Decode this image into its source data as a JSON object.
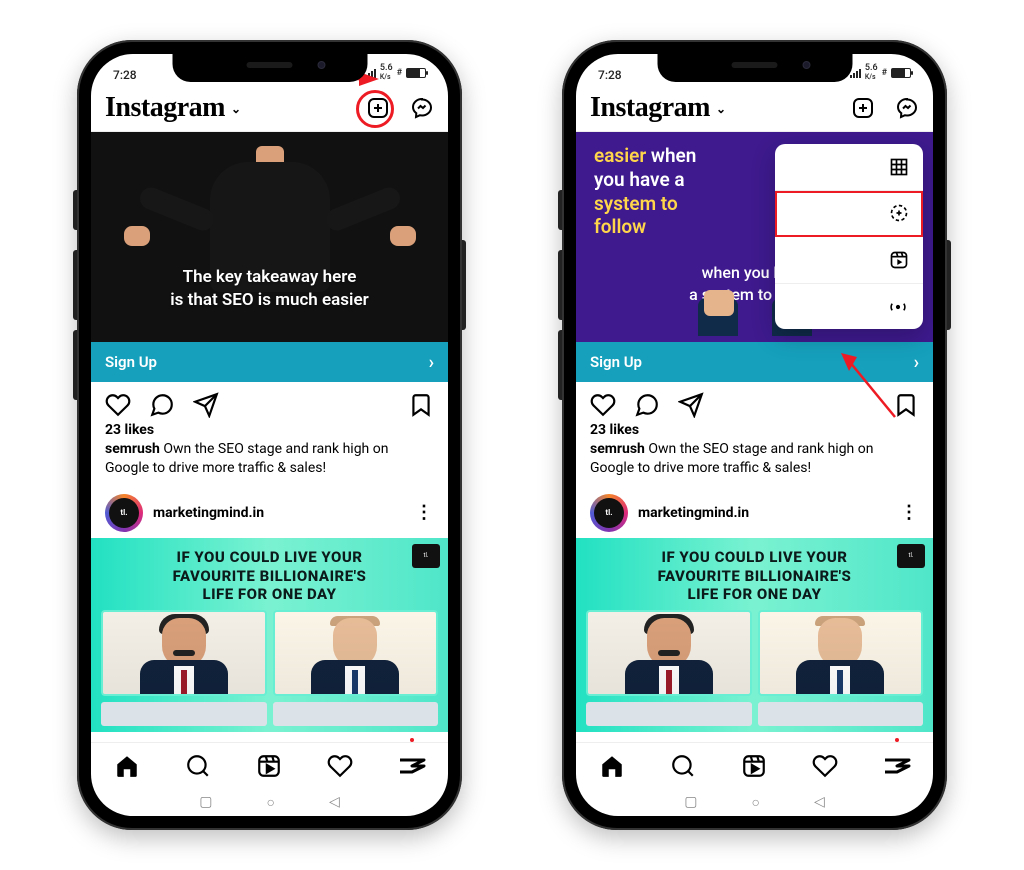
{
  "status": {
    "time": "7:28",
    "net_rate": "5.6",
    "net_unit": "K/s"
  },
  "header": {
    "brand": "Instagram"
  },
  "post1": {
    "media_text_line1": "The key takeaway here",
    "media_text_line2": "is that SEO is much easier",
    "cta": "Sign Up",
    "likes": "23 likes",
    "username": "semrush",
    "caption": "Own the SEO stage and rank high on Google to drive more traffic & sales!"
  },
  "post1b": {
    "line1_pre": "",
    "line1_yl": "easier",
    "line1_post": " when",
    "line2": "you have a",
    "line3_yl": "system to",
    "line4_yl": "follow",
    "sub1": "when you have",
    "sub2": "a system to follow"
  },
  "account2": {
    "name": "marketingmind.in"
  },
  "post2": {
    "line1": "IF YOU COULD LIVE YOUR",
    "line2": "FAVOURITE BILLIONAIRE'S",
    "line3": "LIFE FOR ONE DAY"
  },
  "menu": {
    "items": [
      {
        "label": "Post",
        "icon": "grid"
      },
      {
        "label": "Story",
        "icon": "story"
      },
      {
        "label": "Reel",
        "icon": "reel"
      },
      {
        "label": "Live",
        "icon": "live"
      }
    ]
  },
  "colors": {
    "annotation": "#ed1c24",
    "cta": "#16a0bc",
    "purple": "#3e1a8e"
  }
}
